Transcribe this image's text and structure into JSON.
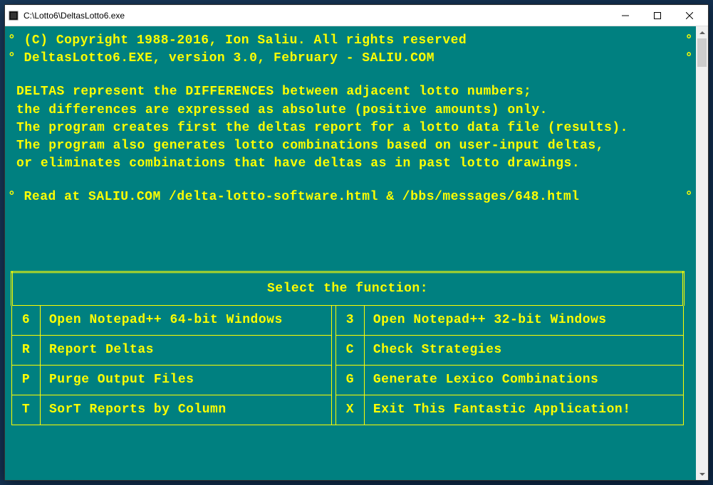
{
  "window": {
    "title": "C:\\Lotto6\\DeltasLotto6.exe"
  },
  "header": {
    "copyright": "(C) Copyright 1988-2016, Ion Saliu. All rights reserved",
    "version": "DeltasLotto6.EXE, version 3.0, February - SALIU.COM"
  },
  "description": {
    "line1": "DELTAS represent the DIFFERENCES between adjacent lotto numbers;",
    "line2": "the differences are expressed as absolute (positive amounts) only.",
    "line3": "The program creates first the deltas report for a lotto data file (results).",
    "line4": "The program also generates lotto combinations based on user-input deltas,",
    "line5": "or eliminates combinations that have deltas as in past lotto drawings."
  },
  "readmore": "Read at SALIU.COM /delta-lotto-software.html & /bbs/messages/648.html",
  "menu": {
    "title": "Select the function:",
    "items": [
      {
        "key": "6",
        "label": "Open Notepad++ 64-bit Windows",
        "key2": "3",
        "label2": "Open Notepad++ 32-bit Windows"
      },
      {
        "key": "R",
        "label": "Report Deltas",
        "key2": "C",
        "label2": "Check Strategies"
      },
      {
        "key": "P",
        "label": "Purge Output Files",
        "key2": "G",
        "label2": "Generate Lexico Combinations"
      },
      {
        "key": "T",
        "label": "SorT Reports by Column",
        "key2": "X",
        "label2": "Exit This Fantastic Application!"
      }
    ]
  },
  "bullet": "°"
}
